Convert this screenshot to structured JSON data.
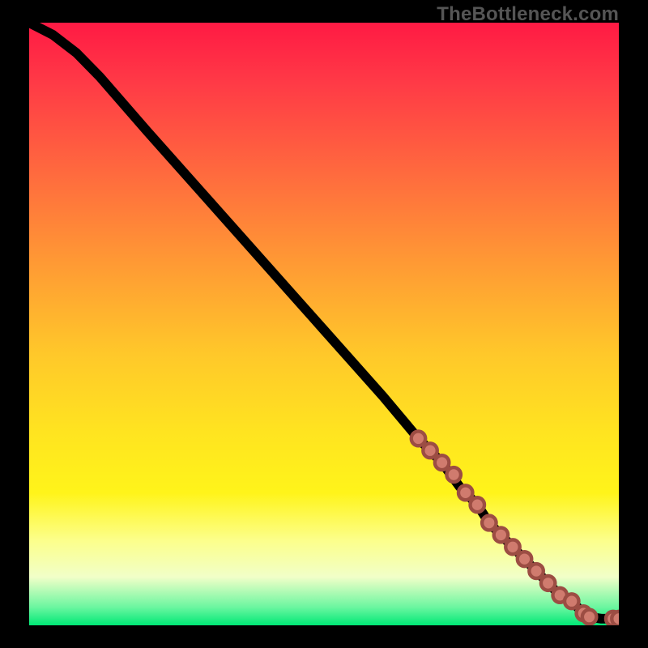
{
  "watermark": "TheBottleneck.com",
  "colors": {
    "page_bg": "#000000",
    "curve": "#000000",
    "marker_fill": "#d07b6e",
    "marker_stroke": "#9c4d43",
    "gradient_stops": [
      "#ff1a44",
      "#ff6a3e",
      "#ffc82a",
      "#fff41a",
      "#fcff8c",
      "#00e876"
    ]
  },
  "chart_data": {
    "type": "line",
    "title": "",
    "xlabel": "",
    "ylabel": "",
    "xlim": [
      0,
      100
    ],
    "ylim": [
      0,
      100
    ],
    "legend": false,
    "grid": false,
    "gradient_from": "red (top)",
    "gradient_to": "green (bottom)",
    "series": [
      {
        "name": "curve",
        "x": [
          0,
          4,
          8,
          12,
          20,
          30,
          40,
          50,
          60,
          66,
          70,
          73,
          76,
          78,
          80,
          82,
          84,
          86,
          88,
          90,
          92,
          94,
          95,
          97,
          100
        ],
        "y": [
          100,
          98,
          95,
          91,
          82,
          71,
          60,
          49,
          38,
          31,
          27,
          23,
          20,
          17,
          15,
          13,
          11,
          9,
          7,
          5,
          4,
          2,
          1.4,
          1.1,
          1.1
        ]
      }
    ],
    "markers": [
      {
        "x": 66,
        "y": 31
      },
      {
        "x": 68,
        "y": 29
      },
      {
        "x": 70,
        "y": 27
      },
      {
        "x": 72,
        "y": 25
      },
      {
        "x": 74,
        "y": 22
      },
      {
        "x": 76,
        "y": 20
      },
      {
        "x": 78,
        "y": 17
      },
      {
        "x": 80,
        "y": 15
      },
      {
        "x": 82,
        "y": 13
      },
      {
        "x": 84,
        "y": 11
      },
      {
        "x": 86,
        "y": 9
      },
      {
        "x": 88,
        "y": 7
      },
      {
        "x": 90,
        "y": 5
      },
      {
        "x": 92,
        "y": 4
      },
      {
        "x": 94,
        "y": 2
      },
      {
        "x": 95,
        "y": 1.4
      },
      {
        "x": 99,
        "y": 1.1
      },
      {
        "x": 100,
        "y": 1.1
      }
    ],
    "marker_radius": 1.2
  }
}
